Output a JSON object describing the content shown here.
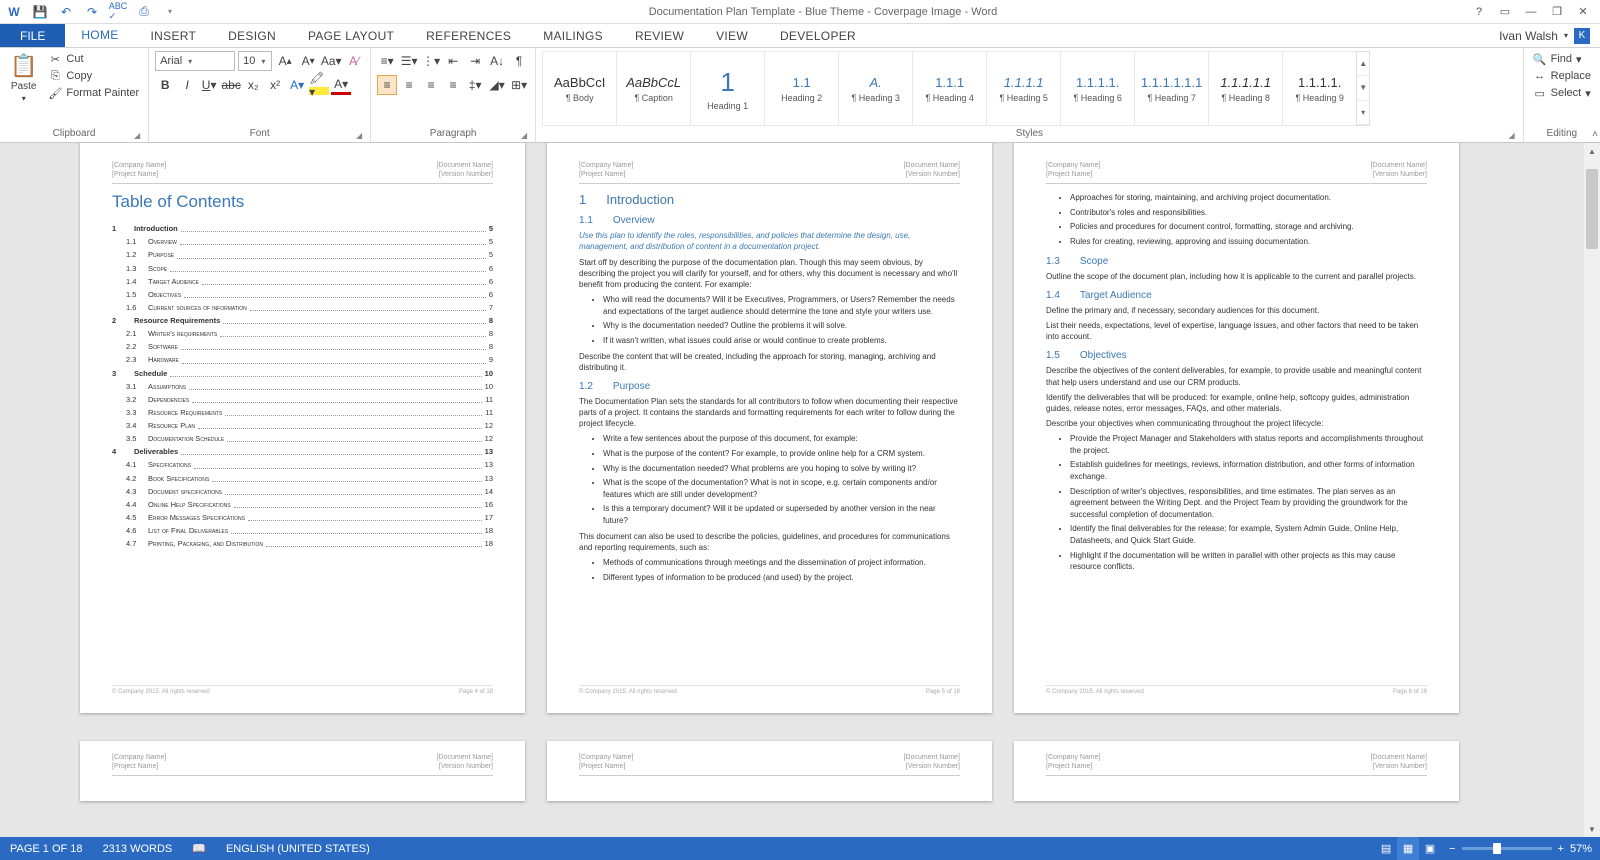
{
  "title": "Documentation Plan Template - Blue Theme - Coverpage Image - Word",
  "user": "Ivan Walsh",
  "userBadge": "K",
  "tabs": {
    "file": "FILE",
    "home": "HOME",
    "insert": "INSERT",
    "design": "DESIGN",
    "page": "PAGE LAYOUT",
    "ref": "REFERENCES",
    "mail": "MAILINGS",
    "review": "REVIEW",
    "view": "VIEW",
    "dev": "DEVELOPER"
  },
  "clipboard": {
    "paste": "Paste",
    "cut": "Cut",
    "copy": "Copy",
    "fmt": "Format Painter",
    "label": "Clipboard"
  },
  "font": {
    "name": "Arial",
    "size": "10",
    "label": "Font"
  },
  "paragraph": {
    "label": "Paragraph"
  },
  "styleItems": [
    {
      "prev": "AaBbCcI",
      "name": "¶ Body"
    },
    {
      "prev": "AaBbCcL",
      "name": "¶ Caption",
      "i": true
    },
    {
      "prev": "1",
      "name": "Heading 1",
      "c": "#3b78b5",
      "big": true
    },
    {
      "prev": "1.1",
      "name": "Heading 2",
      "c": "#3b78b5"
    },
    {
      "prev": "A.",
      "name": "¶ Heading 3",
      "c": "#3b78b5",
      "i": true
    },
    {
      "prev": "1.1.1",
      "name": "¶ Heading 4",
      "c": "#3b78b5"
    },
    {
      "prev": "1.1.1.1",
      "name": "¶ Heading 5",
      "c": "#3b78b5",
      "i": true
    },
    {
      "prev": "1.1.1.1.",
      "name": "¶ Heading 6",
      "c": "#3b78b5"
    },
    {
      "prev": "1.1.1.1.1.1",
      "name": "¶ Heading 7",
      "c": "#3b78b5"
    },
    {
      "prev": "1.1.1.1.1",
      "name": "¶ Heading 8",
      "i": true
    },
    {
      "prev": "1.1.1.1.",
      "name": "¶ Heading 9"
    }
  ],
  "stylesLabel": "Styles",
  "editing": {
    "find": "Find",
    "replace": "Replace",
    "select": "Select",
    "label": "Editing"
  },
  "hdr": {
    "company": "[Company Name]",
    "project": "[Project Name]",
    "docname": "[Document Name]",
    "version": "[Version Number]"
  },
  "ftr": {
    "copy": "© Company 2015. All rights reserved",
    "p4": "Page 4 of 18",
    "p5": "Page 5 of 18",
    "p6": "Page 6 of 18"
  },
  "tocTitle": "Table of Contents",
  "toc": [
    {
      "l": 0,
      "n": "1",
      "t": "Introduction",
      "p": "5"
    },
    {
      "l": 1,
      "n": "1.1",
      "t": "Overview",
      "p": "5"
    },
    {
      "l": 1,
      "n": "1.2",
      "t": "Purpose",
      "p": "5"
    },
    {
      "l": 1,
      "n": "1.3",
      "t": "Scope",
      "p": "6"
    },
    {
      "l": 1,
      "n": "1.4",
      "t": "Target Audience",
      "p": "6"
    },
    {
      "l": 1,
      "n": "1.5",
      "t": "Objectives",
      "p": "6"
    },
    {
      "l": 1,
      "n": "1.6",
      "t": "Current sources of information",
      "p": "7"
    },
    {
      "l": 0,
      "n": "2",
      "t": "Resource Requirements",
      "p": "8"
    },
    {
      "l": 1,
      "n": "2.1",
      "t": "Writer's requirements",
      "p": "8"
    },
    {
      "l": 1,
      "n": "2.2",
      "t": "Software",
      "p": "8"
    },
    {
      "l": 1,
      "n": "2.3",
      "t": "Hardware",
      "p": "9"
    },
    {
      "l": 0,
      "n": "3",
      "t": "Schedule",
      "p": "10"
    },
    {
      "l": 1,
      "n": "3.1",
      "t": "Assumptions",
      "p": "10"
    },
    {
      "l": 1,
      "n": "3.2",
      "t": "Dependencies",
      "p": "11"
    },
    {
      "l": 1,
      "n": "3.3",
      "t": "Resource Requirements",
      "p": "11"
    },
    {
      "l": 1,
      "n": "3.4",
      "t": "Resource Plan",
      "p": "12"
    },
    {
      "l": 1,
      "n": "3.5",
      "t": "Documentation Schedule",
      "p": "12"
    },
    {
      "l": 0,
      "n": "4",
      "t": "Deliverables",
      "p": "13"
    },
    {
      "l": 1,
      "n": "4.1",
      "t": "Specifications",
      "p": "13"
    },
    {
      "l": 1,
      "n": "4.2",
      "t": "Book Specifications",
      "p": "13"
    },
    {
      "l": 1,
      "n": "4.3",
      "t": "Document specifications",
      "p": "14"
    },
    {
      "l": 1,
      "n": "4.4",
      "t": "Online Help Specifications",
      "p": "16"
    },
    {
      "l": 1,
      "n": "4.5",
      "t": "Error Messages Specifications",
      "p": "17"
    },
    {
      "l": 1,
      "n": "4.6",
      "t": "List of Final Deliverables",
      "p": "18"
    },
    {
      "l": 1,
      "n": "4.7",
      "t": "Printing, Packaging, and Distribution",
      "p": "18"
    }
  ],
  "p2": {
    "h1n": "1",
    "h1": "Introduction",
    "s11n": "1.1",
    "s11": "Overview",
    "it": "Use this plan to identify the roles, responsibilities, and policies that determine the design, use, management, and distribution of content in a documentation project.",
    "p1": "Start off by describing the purpose of the documentation plan. Though this may seem obvious, by describing the project you will clarify for yourself, and for others, why this document is necessary and who'll benefit from producing the content. For example:",
    "b1": [
      "Who will read the documents? Will it be Executives, Programmers, or Users? Remember the needs and expectations of the target audience should determine the tone and style your writers use.",
      "Why is the documentation needed? Outline the problems it will solve.",
      "If it wasn't written, what issues could arise or would continue to create problems."
    ],
    "p2": "Describe the content that will be created, including the approach for storing, managing, archiving and distributing it.",
    "s12n": "1.2",
    "s12": "Purpose",
    "p3": "The Documentation Plan sets the standards for all contributors to follow when documenting their respective parts of a project. It contains the standards and formatting requirements for each writer to follow during the project lifecycle.",
    "b2": [
      "Write a few sentences about the purpose of this document, for example:",
      "What is the purpose of the content? For example, to provide online help for a CRM system.",
      "Why is the documentation needed? What problems are you hoping to solve by writing it?",
      "What is the scope of the documentation? What is not in scope, e.g. certain components and/or features which are still under development?",
      "Is this a temporary document? Will it be updated or superseded by another version in the near future?"
    ],
    "p4": "This document can also be used to describe the policies, guidelines, and procedures for communications and reporting requirements, such as:",
    "b3": [
      "Methods of communications through meetings and the dissemination of project information.",
      "Different types of information to be produced (and used) by the project."
    ]
  },
  "p3": {
    "b0": [
      "Approaches for storing, maintaining, and archiving project documentation.",
      "Contributor's roles and responsibilities.",
      "Policies and procedures for document control, formatting, storage and archiving.",
      "Rules for creating, reviewing, approving and issuing documentation."
    ],
    "s13n": "1.3",
    "s13": "Scope",
    "p1": "Outline the scope of the document plan, including how it is applicable to the current and parallel projects.",
    "s14n": "1.4",
    "s14": "Target Audience",
    "p2": "Define the primary and, if necessary, secondary audiences for this document.",
    "p3": "List their needs, expectations, level of expertise, language issues, and other factors that need to be taken into account.",
    "s15n": "1.5",
    "s15": "Objectives",
    "p4": "Describe the objectives of the content deliverables, for example, to provide usable and meaningful content that help users understand and use our CRM products.",
    "p5": "Identify the deliverables that will be produced: for example, online help, softcopy guides, administration guides, release notes, error messages, FAQs, and other materials.",
    "p6": "Describe your objectives when communicating throughout the project lifecycle:",
    "b1": [
      "Provide the Project Manager and Stakeholders with status reports and accomplishments throughout the project.",
      "Establish guidelines for meetings, reviews, information distribution, and other forms of information exchange.",
      "Description of writer's objectives, responsibilities, and time estimates. The plan serves as an agreement between the Writing Dept. and the Project Team by providing the groundwork for the successful completion of documentation.",
      "Identify the final deliverables for the release: for example, System Admin Guide, Online Help, Datasheets, and Quick Start Guide.",
      "Highlight if the documentation will be written in parallel with other projects as this may cause resource conflicts."
    ]
  },
  "status": {
    "page": "PAGE 1 OF 18",
    "words": "2313 WORDS",
    "lang": "ENGLISH (UNITED STATES)",
    "zoom": "57%"
  }
}
